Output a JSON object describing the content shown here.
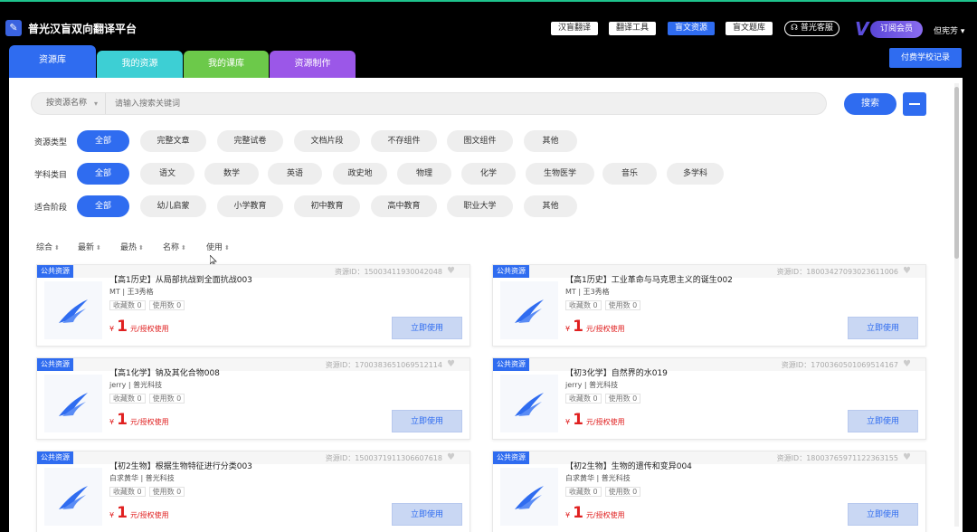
{
  "app": {
    "title": "普光汉盲双向翻译平台",
    "logo_glyph": "✎"
  },
  "header": {
    "buttons": [
      "汉盲翻译",
      "翻译工具",
      "盲文资源",
      "盲文题库"
    ],
    "active_button_index": 2,
    "service_label": "普光客服",
    "member_label": "订阅会员",
    "user_label": "但宪芳"
  },
  "tabs": [
    {
      "label": "资源库",
      "color": "#2f6cf0"
    },
    {
      "label": "我的资源",
      "color": "#3dcfd4"
    },
    {
      "label": "我的课库",
      "color": "#6cc94a"
    },
    {
      "label": "资源制作",
      "color": "#9b57e8"
    }
  ],
  "teacher_button": "付费学校记录",
  "search": {
    "category": "按资源名称",
    "placeholder": "请输入搜索关键词",
    "button": "搜索"
  },
  "filters": [
    {
      "label": "资源类型",
      "options": [
        "全部",
        "完整文章",
        "完整试卷",
        "文档片段",
        "不存组件",
        "图文组件",
        "其他"
      ]
    },
    {
      "label": "学科类目",
      "options": [
        "全部",
        "语文",
        "数学",
        "英语",
        "政史地",
        "物理",
        "化学",
        "生物医学",
        "音乐",
        "多学科"
      ]
    },
    {
      "label": "适合阶段",
      "options": [
        "全部",
        "幼儿启蒙",
        "小学教育",
        "初中教育",
        "高中教育",
        "职业大学",
        "其他"
      ]
    }
  ],
  "sort": [
    "综合",
    "最新",
    "最热",
    "名称",
    "使用"
  ],
  "cards": [
    {
      "badge": "公共资源",
      "title": "【高1历史】从局部抗战到全面抗战003",
      "rid": "资源ID：15003411930042048",
      "meta": "MT | 王3秀格",
      "favorites": "收藏数 0",
      "uses": "使用数 0",
      "currency": "¥",
      "price": "1",
      "price_text": "元/授权使用",
      "button": "立即使用"
    },
    {
      "badge": "公共资源",
      "title": "【高1历史】工业革命与马克思主义的诞生002",
      "rid": "资源ID：18003427093023611006",
      "meta": "MT | 王3秀格",
      "favorites": "收藏数 0",
      "uses": "使用数 0",
      "currency": "¥",
      "price": "1",
      "price_text": "元/授权使用",
      "button": "立即使用"
    },
    {
      "badge": "公共资源",
      "title": "【高1化学】钠及其化合物008",
      "rid": "资源ID：1700383651069512114",
      "meta": "jerry | 普光科技",
      "favorites": "收藏数 0",
      "uses": "使用数 0",
      "currency": "¥",
      "price": "1",
      "price_text": "元/授权使用",
      "button": "立即使用"
    },
    {
      "badge": "公共资源",
      "title": "【初3化学】自然界的水019",
      "rid": "资源ID：1700360501069514167",
      "meta": "jerry | 普光科技",
      "favorites": "收藏数 0",
      "uses": "使用数 0",
      "currency": "¥",
      "price": "1",
      "price_text": "元/授权使用",
      "button": "立即使用"
    },
    {
      "badge": "公共资源",
      "title": "【初2生物】根据生物特征进行分类003",
      "rid": "资源ID：1500371911306607618",
      "meta": "白求黄华 | 普光科技",
      "favorites": "收藏数 0",
      "uses": "使用数 0",
      "currency": "¥",
      "price": "1",
      "price_text": "元/授权使用",
      "button": "立即使用"
    },
    {
      "badge": "公共资源",
      "title": "【初2生物】生物的遗传和变异004",
      "rid": "资源ID：18003765971122363155",
      "meta": "白求黄华 | 普光科技",
      "favorites": "收藏数 0",
      "uses": "使用数 0",
      "currency": "¥",
      "price": "1",
      "price_text": "元/授权使用",
      "button": "立即使用"
    }
  ]
}
